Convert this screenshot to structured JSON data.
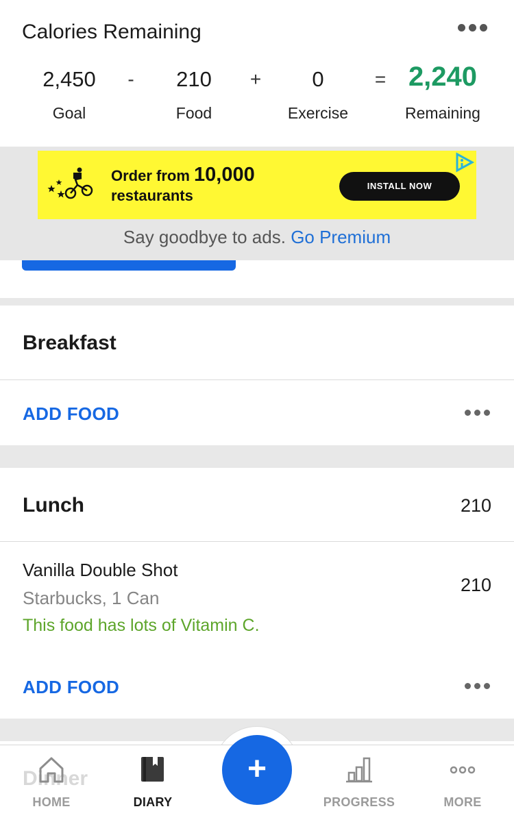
{
  "calories": {
    "title": "Calories Remaining",
    "goal": "2,450",
    "goal_label": "Goal",
    "minus": "-",
    "food": "210",
    "food_label": "Food",
    "plus": "+",
    "exercise": "0",
    "exercise_label": "Exercise",
    "equals": "=",
    "remaining": "2,240",
    "remaining_label": "Remaining",
    "remaining_color": "#1d9a62"
  },
  "ad": {
    "line1": "Order from ",
    "line1_big": "10,000",
    "line2": "restaurants",
    "install": "INSTALL NOW",
    "premium_text": "Say goodbye to ads. ",
    "premium_link": "Go Premium",
    "background": "#fff833"
  },
  "breakfast": {
    "title": "Breakfast",
    "add_food": "ADD FOOD"
  },
  "lunch": {
    "title": "Lunch",
    "calories": "210",
    "items": [
      {
        "name": "Vanilla Double Shot",
        "detail": "Starbucks, 1 Can",
        "note": "This food has lots of Vitamin C.",
        "calories": "210"
      }
    ],
    "add_food": "ADD FOOD"
  },
  "dinner": {
    "title": "Dinner"
  },
  "nav": {
    "home": "HOME",
    "diary": "DIARY",
    "add": "+",
    "progress": "PROGRESS",
    "more": "MORE",
    "active": "diary",
    "accent": "#1668e3"
  },
  "icons": [
    "more-dots-icon",
    "delivery-bike-logo",
    "ad-choices-icon",
    "home-icon",
    "diary-book-icon",
    "plus-icon",
    "progress-chart-icon",
    "more-icon"
  ]
}
